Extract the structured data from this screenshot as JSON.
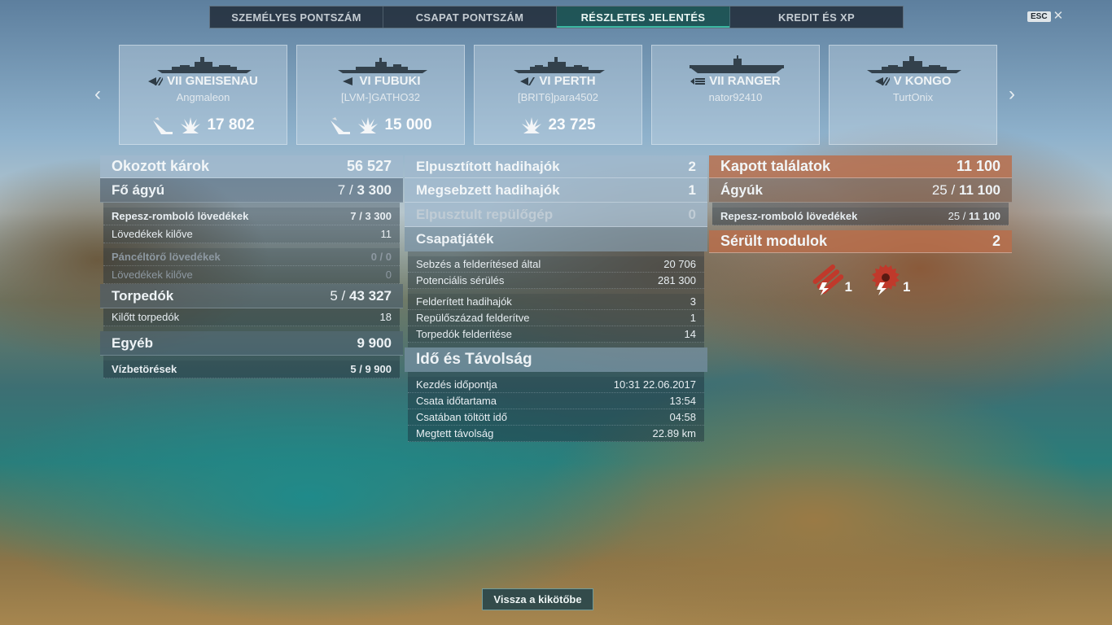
{
  "tabs": [
    "SZEMÉLYES PONTSZÁM",
    "CSAPAT PONTSZÁM",
    "RÉSZLETES JELENTÉS",
    "KREDIT ÉS XP"
  ],
  "active_tab": 2,
  "esc": {
    "key": "ESC",
    "close": "✕"
  },
  "nav": {
    "prev": "‹",
    "next": "›"
  },
  "ships": [
    {
      "name": "VII GNEISENAU",
      "player": "Angmaleon",
      "class_icon": "battleship-icon",
      "achievements": [
        "torpedo-hit-icon",
        "damage-icon"
      ],
      "value": "17 802"
    },
    {
      "name": "VI FUBUKI",
      "player": "[LVM-]GATHO32",
      "class_icon": "destroyer-icon",
      "achievements": [
        "torpedo-hit-icon",
        "damage-icon"
      ],
      "value": "15 000"
    },
    {
      "name": "VI PERTH",
      "player": "[BRIT6]para4502",
      "class_icon": "cruiser-icon",
      "achievements": [
        "damage-icon"
      ],
      "value": "23 725"
    },
    {
      "name": "VII RANGER",
      "player": "nator92410",
      "class_icon": "carrier-icon",
      "achievements": [],
      "value": ""
    },
    {
      "name": "V KONGO",
      "player": "TurtOnix",
      "class_icon": "battleship-icon",
      "achievements": [],
      "value": ""
    }
  ],
  "damage": {
    "title": "Okozott károk",
    "total": "56 527",
    "main_guns": {
      "label": "Fő ágyú",
      "hits": "7",
      "sep": "/",
      "dmg": "3 300"
    },
    "he": {
      "label": "Repesz-romboló lövedékek",
      "hits": "7",
      "sep": "/",
      "dmg": "3 300"
    },
    "he_fired": {
      "label": "Lövedékek kilőve",
      "value": "11"
    },
    "ap": {
      "label": "Páncéltörő lövedékek",
      "value": "0 / 0"
    },
    "ap_fired": {
      "label": "Lövedékek kilőve",
      "value": "0"
    },
    "torpedoes": {
      "label": "Torpedók",
      "hits": "5",
      "sep": "/",
      "dmg": "43 327"
    },
    "torp_fired": {
      "label": "Kilőtt torpedók",
      "value": "18"
    },
    "other": {
      "label": "Egyéb",
      "value": "9 900"
    },
    "flooding": {
      "label": "Vízbetörések",
      "hits": "5",
      "sep": "/",
      "dmg": "9 900"
    }
  },
  "middle": {
    "destroyed": {
      "label": "Elpusztított hadihajók",
      "value": "2"
    },
    "damaged": {
      "label": "Megsebzett hadihajók",
      "value": "1"
    },
    "planes": {
      "label": "Elpusztult repülőgép",
      "value": "0"
    },
    "teamplay": {
      "title": "Csapatjáték",
      "rows": [
        {
          "label": "Sebzés a felderítésed által",
          "value": "20 706"
        },
        {
          "label": "Potenciális sérülés",
          "value": "281 300"
        },
        {
          "label": "Felderített hadihajók",
          "value": "3"
        },
        {
          "label": "Repülőszázad felderítve",
          "value": "1"
        },
        {
          "label": "Torpedók felderítése",
          "value": "14"
        }
      ]
    },
    "time": {
      "title": "Idő és Távolság",
      "rows": [
        {
          "label": "Kezdés időpontja",
          "value": "10:31  22.06.2017"
        },
        {
          "label": "Csata időtartama",
          "value": "13:54"
        },
        {
          "label": "Csatában töltött idő",
          "value": "04:58"
        },
        {
          "label": "Megtett távolság",
          "value": "22.89 km"
        }
      ]
    }
  },
  "received": {
    "title": "Kapott találatok",
    "total": "11 100",
    "guns": {
      "label": "Ágyúk",
      "hits": "25",
      "sep": "/",
      "dmg": "11 100"
    },
    "he": {
      "label": "Repesz-romboló lövedékek",
      "hits": "25",
      "sep": "/",
      "dmg": "11 100"
    },
    "modules_title": "Sérült modulok",
    "modules_total": "2",
    "modules": [
      {
        "icon": "torpedo-tubes-damaged-icon",
        "count": "1"
      },
      {
        "icon": "engine-damaged-icon",
        "count": "1"
      }
    ]
  },
  "back_button": "Vissza a kikötőbe"
}
